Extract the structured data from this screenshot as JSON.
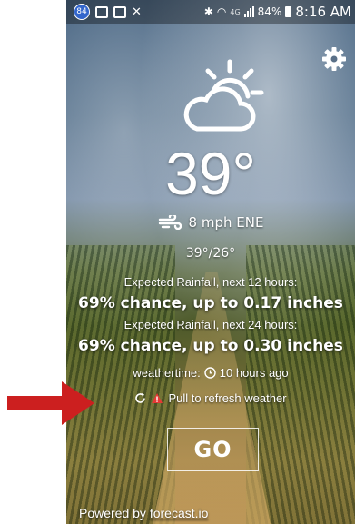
{
  "status_bar": {
    "badge": "84",
    "network": "4G",
    "battery": "84%",
    "time": "8:16 AM"
  },
  "weather": {
    "icon": "partly-cloudy-day-icon",
    "temperature": "39°",
    "wind": "8 mph ENE",
    "hi_lo": "39°/26°",
    "rain_12_label": "Expected Rainfall, next 12 hours:",
    "rain_12_value": "69% chance, up to 0.17 inches",
    "rain_24_label": "Expected Rainfall, next 24 hours:",
    "rain_24_value": "69% chance, up to 0.30 inches",
    "weathertime_label": "weathertime:",
    "weathertime_value": "10 hours ago",
    "refresh_text": "Pull to refresh weather"
  },
  "go_button": "GO",
  "footer": {
    "prefix": "Powered by ",
    "link": "forecast.io"
  },
  "colors": {
    "arrow": "#cc1f1f",
    "warning": "#e53935",
    "text": "#ffffff"
  }
}
